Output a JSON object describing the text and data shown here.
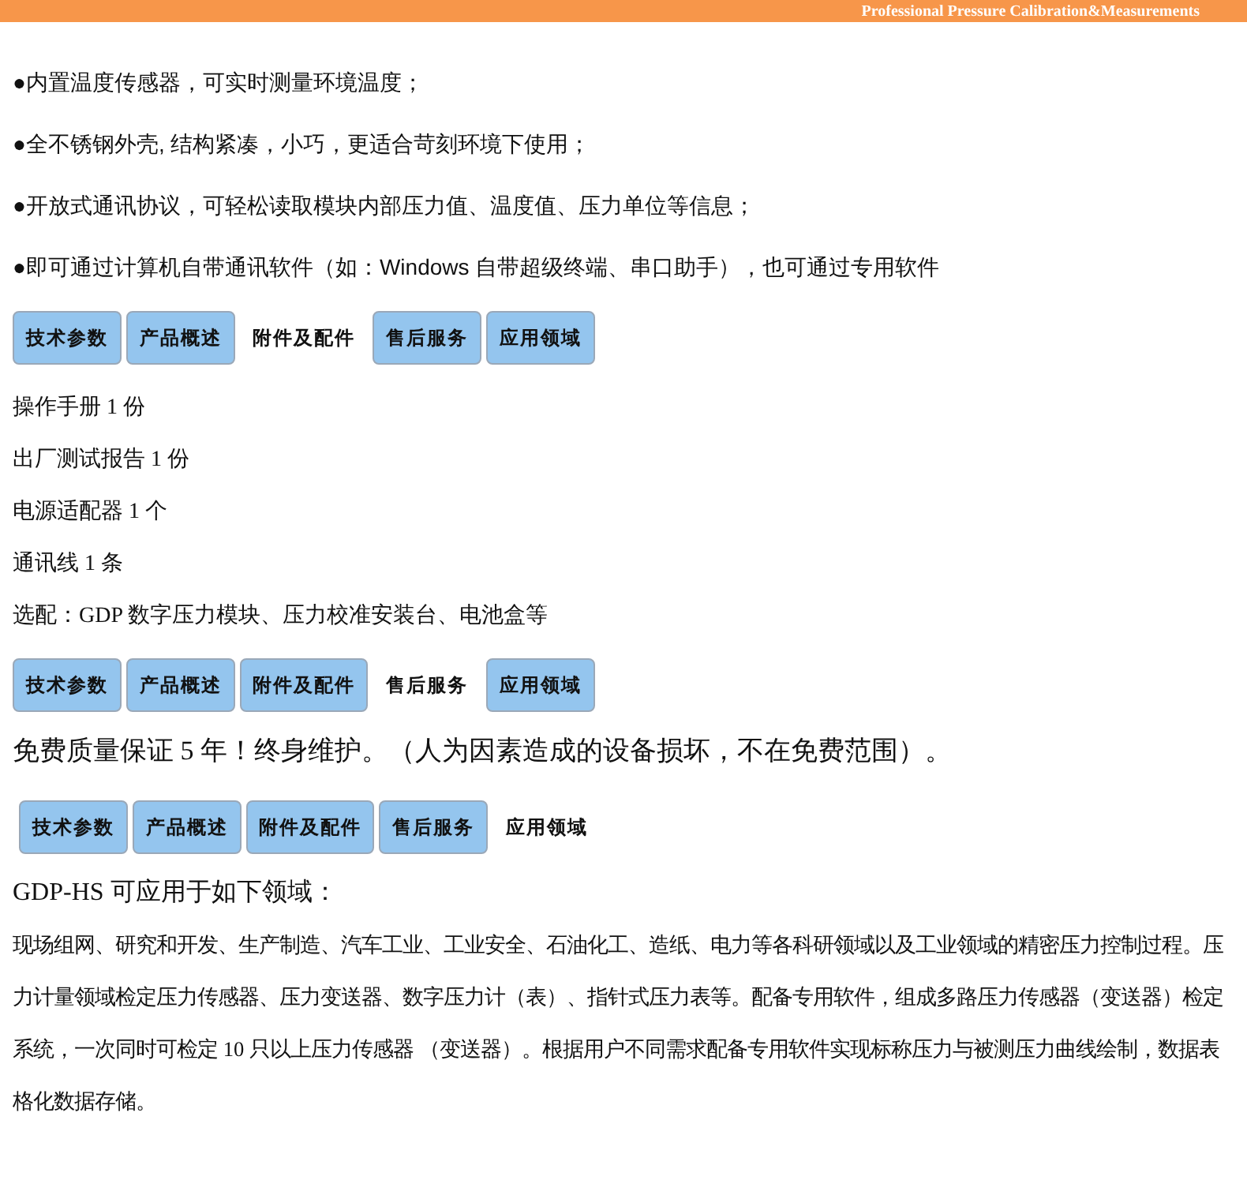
{
  "header": {
    "tagline": "Professional Pressure Calibration&Measurements"
  },
  "features": [
    "●内置温度传感器，可实时测量环境温度；",
    "●全不锈钢外壳, 结构紧凑，小巧，更适合苛刻环境下使用；",
    "●开放式通讯协议，可轻松读取模块内部压力值、温度值、压力单位等信息；",
    "●即可通过计算机自带通讯软件（如：Windows 自带超级终端、串口助手），也可通过专用软件"
  ],
  "sections": [
    {
      "tabs": [
        {
          "label": "技术参数",
          "selected": false
        },
        {
          "label": "产品概述",
          "selected": false
        },
        {
          "label": "附件及配件",
          "selected": true
        },
        {
          "label": "售后服务",
          "selected": false
        },
        {
          "label": "应用领域",
          "selected": false
        }
      ],
      "blocks": [
        {
          "kind": "line",
          "text": "操作手册  1 份"
        },
        {
          "kind": "line",
          "text": "出厂测试报告  1 份"
        },
        {
          "kind": "line",
          "text": "电源适配器  1 个"
        },
        {
          "kind": "line",
          "text": "通讯线  1 条"
        },
        {
          "kind": "line",
          "text": "选配：GDP 数字压力模块、压力校准安装台、电池盒等"
        }
      ]
    },
    {
      "tabs": [
        {
          "label": "技术参数",
          "selected": false
        },
        {
          "label": "产品概述",
          "selected": false
        },
        {
          "label": "附件及配件",
          "selected": false
        },
        {
          "label": "售后服务",
          "selected": true
        },
        {
          "label": "应用领域",
          "selected": false
        }
      ],
      "blocks": [
        {
          "kind": "notice",
          "text": "免费质量保证 5 年！终身维护。（人为因素造成的设备损坏，不在免费范围）。"
        }
      ]
    },
    {
      "tabs": [
        {
          "label": "技术参数",
          "selected": false
        },
        {
          "label": "产品概述",
          "selected": false
        },
        {
          "label": "附件及配件",
          "selected": false
        },
        {
          "label": "售后服务",
          "selected": false
        },
        {
          "label": "应用领域",
          "selected": true
        }
      ],
      "blocks": [
        {
          "kind": "heading",
          "text": "GDP-HS 可应用于如下领域："
        },
        {
          "kind": "paragraph",
          "text": "现场组网、研究和开发、生产制造、汽车工业、工业安全、石油化工、造纸、电力等各科研领域以及工业领域的精密压力控制过程。压力计量领域检定压力传感器、压力变送器、数字压力计（表）、指针式压力表等。配备专用软件，组成多路压力传感器（变送器）检定系统，一次同时可检定 10 只以上压力传感器 （变送器）。根据用户不同需求配备专用软件实现标称压力与被测压力曲线绘制，数据表格化数据存储。"
        }
      ]
    }
  ]
}
